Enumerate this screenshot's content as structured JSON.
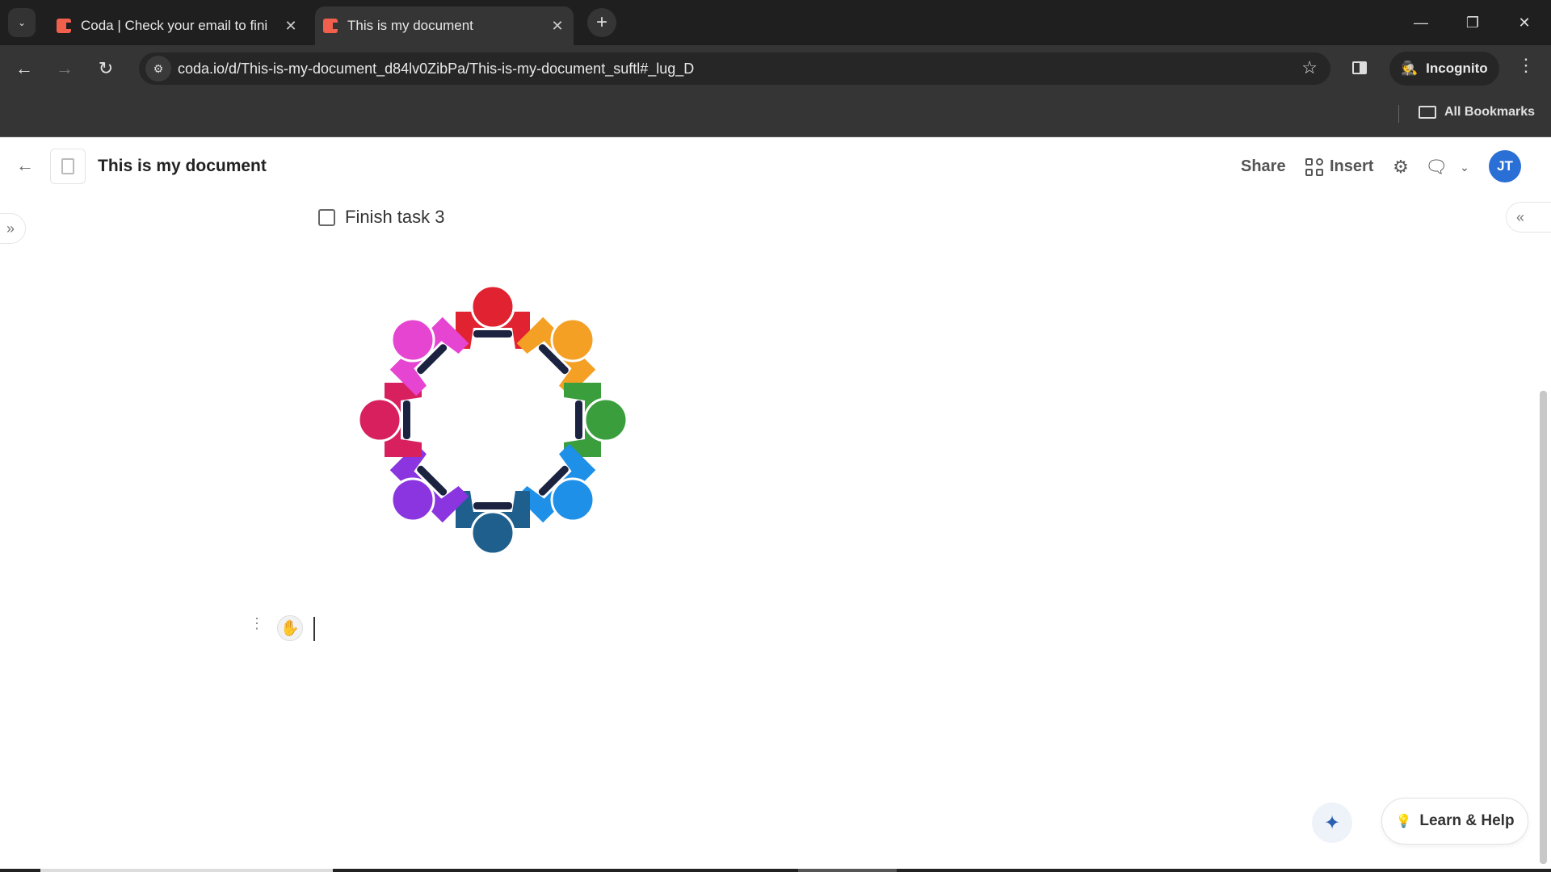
{
  "browser": {
    "tabs": [
      {
        "title": "Coda | Check your email to fini",
        "active": false
      },
      {
        "title": "This is my document",
        "active": true
      }
    ],
    "new_tab": "+",
    "tab_close": "✕",
    "tab_list": "⌄",
    "window_controls": {
      "minimize": "—",
      "restore": "❐",
      "close": "✕"
    },
    "nav": {
      "back": "←",
      "forward": "→",
      "reload": "↻"
    },
    "address": {
      "url": "coda.io/d/This-is-my-document_d84lv0ZibPa/This-is-my-document_suftl#_lug_D",
      "site_info": "⚙"
    },
    "bookmark_star": "☆",
    "profile": {
      "label": "Incognito",
      "icon": "🕵"
    },
    "menu": "⋮",
    "bookmarks_bar": {
      "all_bookmarks": "All Bookmarks"
    }
  },
  "doc": {
    "back": "←",
    "title": "This is my document",
    "header": {
      "share": "Share",
      "insert": "Insert",
      "settings_icon": "⚙",
      "comments_icon": "🗨",
      "dropdown": "⌄",
      "avatar_initials": "JT",
      "avatar_color": "#2a6fd6"
    },
    "expand_sidebar": "»",
    "collapse_panel": "«",
    "task": {
      "label": "Finish task 3",
      "checked": false
    },
    "image": {
      "alt": "Eight colorful people seated around a round table, viewed from above",
      "people_colors": [
        "#e12230",
        "#f4a024",
        "#3a9e3c",
        "#1e90e8",
        "#1f5f8e",
        "#8a35e0",
        "#d8205f",
        "#e645d2"
      ]
    },
    "row_handle": "⋮",
    "drag_hand": "✋"
  },
  "floating": {
    "ai_icon": "✦",
    "help": {
      "label": "Learn & Help",
      "icon": "💡"
    }
  }
}
